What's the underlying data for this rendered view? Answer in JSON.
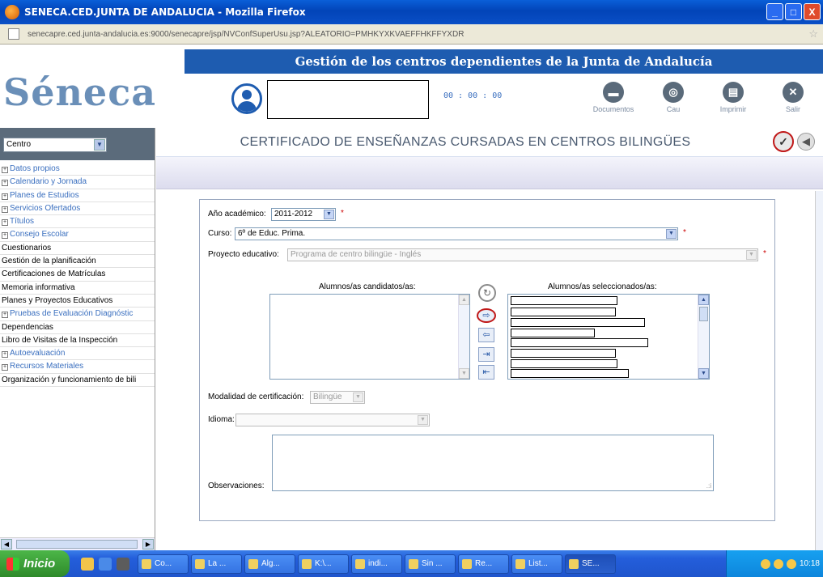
{
  "browser": {
    "title": "SENECA.CED.JUNTA DE ANDALUCIA - Mozilla Firefox",
    "url": "senecapre.ced.junta-andalucia.es:9000/senecapre/jsp/NVConfSuperUsu.jsp?ALEATORIO=PMHKYXKVAEFFHKFFYXDR",
    "window_buttons": {
      "minimize": "_",
      "maximize": "□",
      "close": "X"
    }
  },
  "header": {
    "logo": "Séneca",
    "banner": "Gestión de los centros dependientes de la Junta de Andalucía",
    "timer": "00 : 00 : 00",
    "buttons": [
      {
        "label": "Documentos",
        "icon": "documents-icon"
      },
      {
        "label": "Cau",
        "icon": "support-icon"
      },
      {
        "label": "Imprimir",
        "icon": "printer-icon"
      },
      {
        "label": "Salir",
        "icon": "close-icon"
      }
    ]
  },
  "sidebar": {
    "centro_select": "Centro",
    "items": [
      {
        "label": "Datos propios",
        "expandable": true
      },
      {
        "label": "Calendario y Jornada",
        "expandable": true
      },
      {
        "label": "Planes de Estudios",
        "expandable": true
      },
      {
        "label": "Servicios Ofertados",
        "expandable": true
      },
      {
        "label": "Títulos",
        "expandable": true
      },
      {
        "label": "Consejo Escolar",
        "expandable": true
      },
      {
        "label": "Cuestionarios",
        "expandable": false
      },
      {
        "label": "Gestión de la planificación",
        "expandable": false
      },
      {
        "label": "Certificaciones de Matrículas",
        "expandable": false
      },
      {
        "label": "Memoria informativa",
        "expandable": false
      },
      {
        "label": "Planes y Proyectos Educativos",
        "expandable": false
      },
      {
        "label": "Pruebas de Evaluación Diagnóstic",
        "expandable": true
      },
      {
        "label": "Dependencias",
        "expandable": false
      },
      {
        "label": "Libro de Visitas de la Inspección",
        "expandable": false
      },
      {
        "label": "Autoevaluación",
        "expandable": true
      },
      {
        "label": "Recursos Materiales",
        "expandable": true
      },
      {
        "label": "Organización y funcionamiento de bili",
        "expandable": false
      }
    ]
  },
  "main": {
    "title": "CERTIFICADO DE ENSEÑANZAS CURSADAS EN CENTROS BILINGÜES",
    "form": {
      "anio_label": "Año académico:",
      "anio_value": "2011-2012",
      "curso_label": "Curso:",
      "curso_value": "6º de Educ. Prima.",
      "proyecto_label": "Proyecto educativo:",
      "proyecto_value": "Programa de centro bilingüe - Inglés",
      "candidatos_label": "Alumnos/as candidatos/as:",
      "seleccionados_label": "Alumnos/as seleccionados/as:",
      "modalidad_label": "Modalidad de certificación:",
      "modalidad_value": "Bilingüe",
      "idioma_label": "Idioma:",
      "idioma_value": "",
      "observaciones_label": "Observaciones:",
      "required_mark": "*"
    }
  },
  "taskbar": {
    "start": "Inicio",
    "tasks": [
      "Co...",
      "La ...",
      "Alg...",
      "K:\\...",
      "indi...",
      "Sin ...",
      "Re...",
      "List...",
      "SE..."
    ],
    "clock": "10:18"
  }
}
